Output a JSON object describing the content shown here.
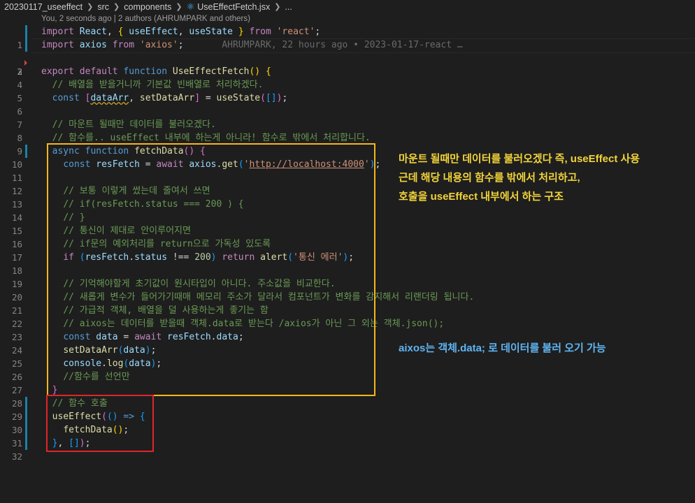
{
  "breadcrumb": {
    "items": [
      "20230117_useeffect",
      "src",
      "components",
      "UseEffectFetch.jsx",
      "..."
    ]
  },
  "blame_header": "You, 2 seconds ago | 2 authors (AHRUMPARK and others)",
  "inline_blame": "AHRUMPARK, 22 hours ago • 2023-01-17-react …",
  "line_numbers": [
    "1",
    "2",
    "3",
    "4",
    "5",
    "6",
    "7",
    "8",
    "9",
    "10",
    "11",
    "12",
    "13",
    "14",
    "15",
    "16",
    "17",
    "18",
    "19",
    "20",
    "21",
    "22",
    "23",
    "24",
    "25",
    "26",
    "27",
    "28",
    "29",
    "30",
    "31",
    "32"
  ],
  "annotations": {
    "yellow_note": [
      "마운트 될때만 데이터를 불러오겠다 즉, useEffect 사용",
      "근데 해당 내용의 함수를 밖에서 처리하고,",
      "호출을 useEffect 내부에서 하는 구조"
    ],
    "blue_note": "aixos는 객체.data; 로 데이터를 불러 오기 가능"
  },
  "colors": {
    "background": "#1e1e1e",
    "yellow_box": "#f5b61f",
    "red_box": "#e0242a",
    "yellow_note": "#f2d43a",
    "blue_note": "#5fb4f2"
  }
}
